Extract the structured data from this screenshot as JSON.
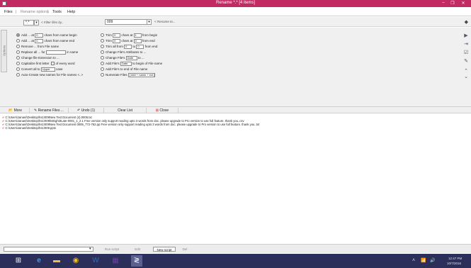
{
  "window": {
    "title": "Rename  *.*  [4 items]",
    "min": "–",
    "restore": "❐",
    "close": "✕"
  },
  "menu": {
    "files": "Files",
    "sep": "|",
    "rename_options": "Rename options",
    "tools": "Tools",
    "help": "Help"
  },
  "filter": {
    "mask": "*.*",
    "filter_hint": "< Filter files by..",
    "rename_value": "009",
    "rename_hint": "< Rename to..."
  },
  "options": {
    "side_label": "Options",
    "left": [
      {
        "pre": "Add ... at",
        "val1": "0",
        "post": "chars from name begin",
        "selected": true
      },
      {
        "pre": "Add ... at",
        "val1": "0",
        "post": "chars from name end",
        "selected": false
      },
      {
        "pre": "Remove ... from File name",
        "selected": false
      },
      {
        "pre": "Replace all ... for",
        "post": "in name",
        "selected": false
      },
      {
        "pre": "Change file Extension to ...",
        "selected": false
      },
      {
        "pre": "Capitalize first letter",
        "post": "of every word",
        "selected": false
      },
      {
        "pre": "Convert all to",
        "val1": "Upper",
        "post": "case",
        "selected": false
      },
      {
        "pre": "Auto-Create new names for File names <..>",
        "selected": false
      }
    ],
    "right": [
      {
        "pre": "Trim",
        "val1": "0",
        "mid": "chars at",
        "val2": "1",
        "post": "from begin",
        "selected": false
      },
      {
        "pre": "Trim",
        "val1": "0",
        "mid": "chars at",
        "val2": "0",
        "post": "from end",
        "selected": false
      },
      {
        "pre": "Trim all from",
        "val1": "0",
        "mid": "to",
        "val2": "0",
        "post": "from end",
        "selected": false
      },
      {
        "pre": "Change File's Attributes to ...",
        "selected": false
      },
      {
        "pre": "Change File's",
        "val1": "Date",
        "post": "to ...",
        "selected": false
      },
      {
        "pre": "Add File's",
        "val1": "Date",
        "post": "to begin of File name",
        "selected": false
      },
      {
        "pre": "Add File's",
        "post": "to end of File name",
        "selected": false
      },
      {
        "pre": "Numerate Files",
        "val1": "[ ### + name + ext ]",
        "selected": false
      }
    ]
  },
  "actions": {
    "more_files": "More Files...",
    "rename_files": "Rename Files ...",
    "undo": "Undo (1)",
    "clear_list": "Clear List",
    "close": "Close"
  },
  "files": [
    "C:\\Users\\Janani\\Desktop\\hs1\\009New Text Document (4).0006.txt",
    "C:\\Users\\Janani\\Desktop\\hs1\\009hsEight3Late-0001_1_2.1 Free version only support reading upto 3 words from doc. please upgrade to Pro version to use full feature. thank you..csv",
    "C:\\Users\\Janani\\Desktop\\hs1\\009New Text Document 0009_772-762.pp Free version only support reading upto 3 words from doc. please upgrade to Pro version to use full feature. thank you..txt",
    "C:\\Users\\Janani\\Desktop\\hs1\\009.pptx"
  ],
  "script": {
    "dropdown_value": "",
    "run": "Run script",
    "edit": "Edit",
    "new_script": "New script",
    "del": "Del"
  },
  "tray": {
    "time": "12:47 PM",
    "date": "10/7/2016"
  },
  "colors": {
    "titlebar": "#c22a63",
    "taskbar": "#2b2f5a",
    "marker": "#c0392b"
  }
}
